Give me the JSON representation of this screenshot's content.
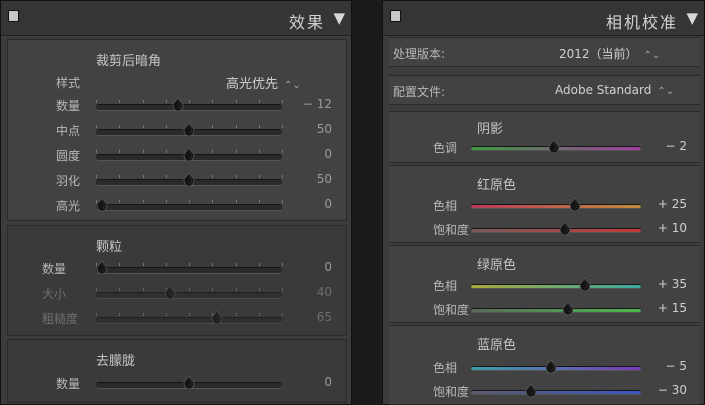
{
  "left": {
    "title": "效果",
    "vignette": {
      "title": "裁剪后暗角",
      "style_label": "样式",
      "style_value": "高光优先",
      "sliders": [
        {
          "label": "数量",
          "value": "− 12",
          "pos": 0.44
        },
        {
          "label": "中点",
          "value": "50",
          "pos": 0.5
        },
        {
          "label": "圆度",
          "value": "0",
          "pos": 0.5
        },
        {
          "label": "羽化",
          "value": "50",
          "pos": 0.5
        },
        {
          "label": "高光",
          "value": "0",
          "pos": 0.03
        }
      ]
    },
    "grain": {
      "title": "颗粒",
      "sliders": [
        {
          "label": "数量",
          "value": "0",
          "pos": 0.03
        },
        {
          "label": "大小",
          "value": "40",
          "pos": 0.4
        },
        {
          "label": "粗糙度",
          "value": "65",
          "pos": 0.65
        }
      ]
    },
    "dehaze": {
      "title": "去朦胧",
      "sliders": [
        {
          "label": "数量",
          "value": "0",
          "pos": 0.5
        }
      ]
    }
  },
  "right": {
    "title": "相机校准",
    "process_label": "处理版本:",
    "process_value": "2012（当前）",
    "profile_label": "配置文件:",
    "profile_value": "Adobe Standard",
    "shadows": {
      "title": "阴影",
      "sliders": [
        {
          "label": "色调",
          "value": "− 2",
          "pos": 0.49,
          "from": "#3c9a3c",
          "to": "#a23ca2"
        }
      ]
    },
    "red": {
      "title": "红原色",
      "sliders": [
        {
          "label": "色相",
          "value": "+ 25",
          "pos": 0.61,
          "from": "#b83a5a",
          "to": "#c28a3a"
        },
        {
          "label": "饱和度",
          "value": "+ 10",
          "pos": 0.55,
          "from": "#7a5a5a",
          "to": "#c23a3a"
        }
      ]
    },
    "green": {
      "title": "绿原色",
      "sliders": [
        {
          "label": "色相",
          "value": "+ 35",
          "pos": 0.67,
          "from": "#a8a83a",
          "to": "#3aa8a0"
        },
        {
          "label": "饱和度",
          "value": "+ 15",
          "pos": 0.57,
          "from": "#5a6a5a",
          "to": "#4cb84c"
        }
      ]
    },
    "blue": {
      "title": "蓝原色",
      "sliders": [
        {
          "label": "色相",
          "value": "− 5",
          "pos": 0.47,
          "from": "#3aa0a8",
          "to": "#7a3ab8"
        },
        {
          "label": "饱和度",
          "value": "− 30",
          "pos": 0.35,
          "from": "#5a5a6a",
          "to": "#3a56c2"
        }
      ]
    }
  }
}
